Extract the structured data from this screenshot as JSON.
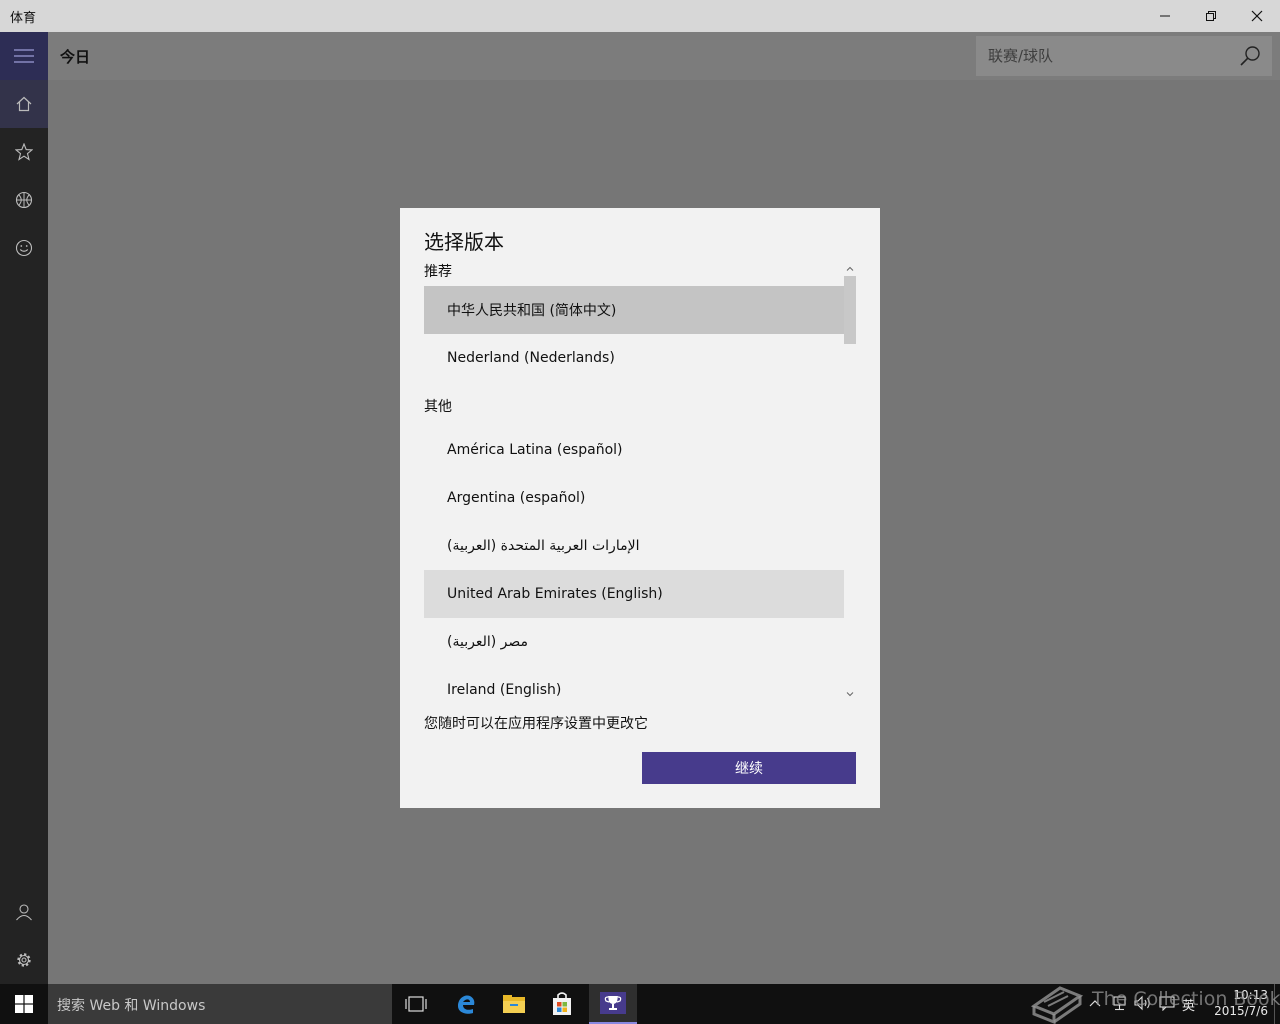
{
  "window": {
    "title": "体育"
  },
  "header": {
    "page_title": "今日",
    "search_placeholder": "联赛/球队"
  },
  "sidebar": {
    "items": [
      {
        "name": "menu-icon"
      },
      {
        "name": "home-icon",
        "active": true
      },
      {
        "name": "star-icon"
      },
      {
        "name": "basketball-icon"
      },
      {
        "name": "smiley-icon"
      },
      {
        "name": "person-icon"
      },
      {
        "name": "gear-icon"
      }
    ]
  },
  "dialog": {
    "title": "选择版本",
    "recommended_header": "推荐",
    "recommended": [
      {
        "label": "中华人民共和国 (简体中文)",
        "state": "selected"
      },
      {
        "label": "Nederland (Nederlands)"
      }
    ],
    "other_header": "其他",
    "other": [
      {
        "label": "América Latina (español)"
      },
      {
        "label": "Argentina (español)"
      },
      {
        "label": "الإمارات العربية المتحدة (العربية)"
      },
      {
        "label": "United Arab Emirates (English)",
        "state": "hover"
      },
      {
        "label": "مصر (العربية)"
      },
      {
        "label": "Ireland (English)"
      }
    ],
    "hint": "您随时可以在应用程序设置中更改它",
    "continue_label": "继续"
  },
  "taskbar": {
    "search_text": "搜索 Web 和 Windows",
    "apps": [
      "task-view-icon",
      "edge-icon",
      "file-explorer-icon",
      "store-icon",
      "sports-app-icon"
    ],
    "active_app": "sports-app-icon"
  },
  "tray": {
    "lang": "英",
    "time": "10:13",
    "date": "2015/7/6"
  },
  "watermark": {
    "text": "The Collection Book"
  },
  "colors": {
    "accent": "#473b8c",
    "sidebar": "#232323",
    "overlay": "#767676",
    "dialog": "#f2f2f2",
    "selected": "#c4c4c4"
  }
}
